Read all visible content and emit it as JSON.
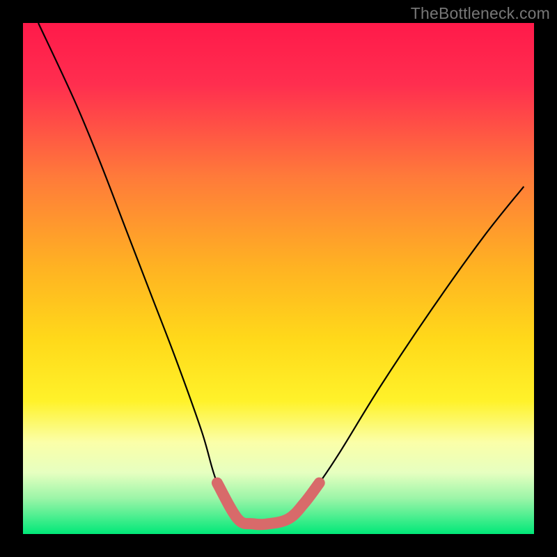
{
  "watermark": "TheBottleneck.com",
  "chart_data": {
    "type": "line",
    "title": "",
    "xlabel": "",
    "ylabel": "",
    "xlim": [
      0,
      100
    ],
    "ylim": [
      0,
      100
    ],
    "series": [
      {
        "name": "bottleneck-curve",
        "x": [
          3,
          10,
          15,
          20,
          25,
          30,
          35,
          38,
          42,
          45,
          48,
          52,
          55,
          58,
          62,
          70,
          80,
          90,
          98
        ],
        "y": [
          100,
          85,
          73,
          60,
          47,
          34,
          20,
          10,
          3,
          2,
          2,
          3,
          6,
          10,
          16,
          29,
          44,
          58,
          68
        ]
      }
    ],
    "highlight_segment": {
      "name": "optimal-zone",
      "x": [
        38,
        42,
        45,
        48,
        52,
        55,
        58
      ],
      "y": [
        10,
        3,
        2,
        2,
        3,
        6,
        10
      ]
    },
    "background_gradient": {
      "top": "#ff1a4a",
      "mid": "#ffd000",
      "low": "#faffb0",
      "bottom": "#00e878"
    },
    "frame_color": "#000000"
  }
}
